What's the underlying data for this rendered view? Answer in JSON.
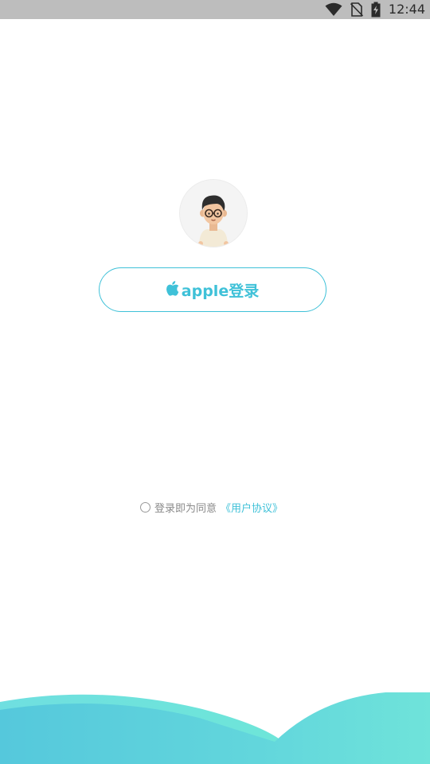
{
  "status_bar": {
    "time": "12:44",
    "icons": [
      "wifi-icon",
      "no-sim-icon",
      "battery-charging-icon"
    ]
  },
  "avatar": {
    "icon": "avatar-boy-glasses"
  },
  "login": {
    "apple_label": "apple登录",
    "apple_icon": "apple-logo-icon",
    "accent_color": "#3fc1d8"
  },
  "agreement": {
    "prefix": "登录即为同意",
    "link": "《用户协议》",
    "checked": false
  },
  "colors": {
    "accent": "#3fc1d8",
    "wave_start": "#5cc9dd",
    "wave_end": "#6ee0d8"
  }
}
